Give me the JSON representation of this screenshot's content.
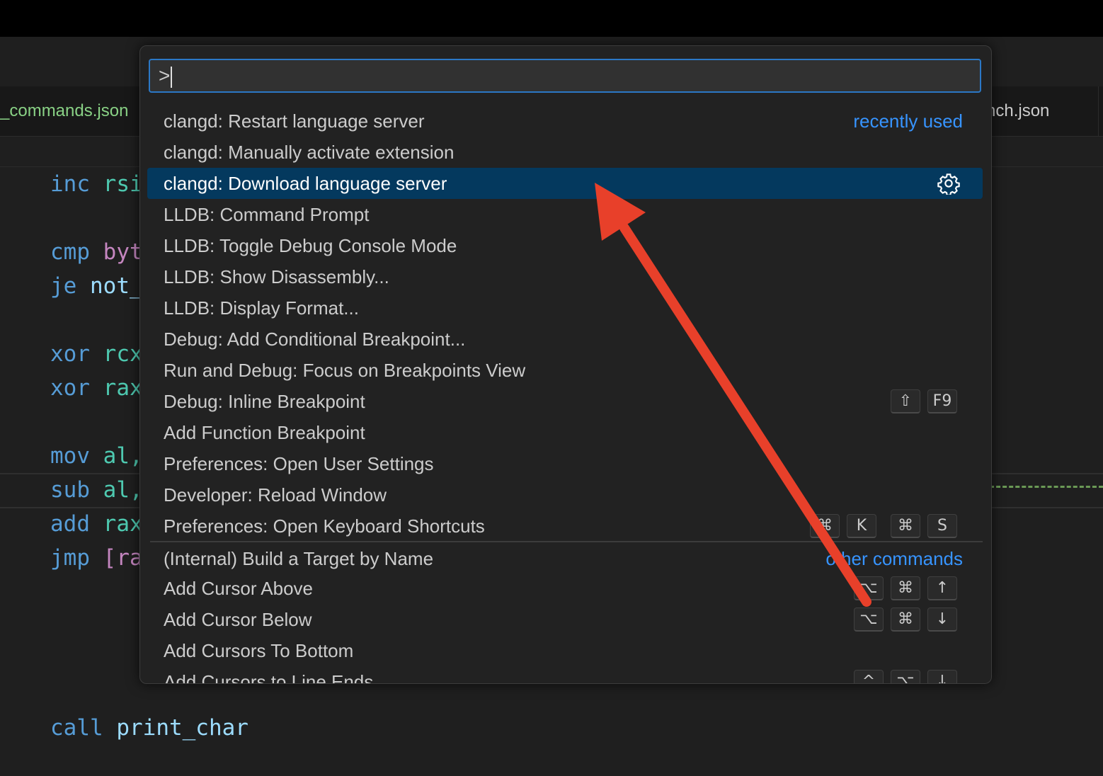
{
  "tabs": {
    "left": "_commands.json",
    "right": "nch.json"
  },
  "editor": {
    "lines": [
      {
        "op": "inc",
        "arg": "rsi"
      },
      {
        "op": "cmp",
        "arg": "byt"
      },
      {
        "op": "je",
        "arg": "not_"
      },
      {
        "op": "xor",
        "arg": "rcx"
      },
      {
        "op": "xor",
        "arg": "rax"
      },
      {
        "op": "mov",
        "arg": "al,"
      },
      {
        "op": "sub",
        "arg": "al,"
      },
      {
        "op": "add",
        "arg": "rax"
      },
      {
        "op": "jmp",
        "arg": "[ra"
      },
      {
        "op": "call",
        "arg": "print_char"
      }
    ]
  },
  "palette": {
    "input_value": ">",
    "items": [
      {
        "label": "clangd: Restart language server",
        "hint": "recently used",
        "keys": []
      },
      {
        "label": "clangd: Manually activate extension",
        "hint": "",
        "keys": []
      },
      {
        "label": "clangd: Download language server",
        "hint": "",
        "keys": [],
        "selected": true,
        "icon": "gear-icon"
      },
      {
        "label": "LLDB: Command Prompt",
        "hint": "",
        "keys": []
      },
      {
        "label": "LLDB: Toggle Debug Console Mode",
        "hint": "",
        "keys": []
      },
      {
        "label": "LLDB: Show Disassembly...",
        "hint": "",
        "keys": []
      },
      {
        "label": "LLDB: Display Format...",
        "hint": "",
        "keys": []
      },
      {
        "label": "Debug: Add Conditional Breakpoint...",
        "hint": "",
        "keys": []
      },
      {
        "label": "Run and Debug: Focus on Breakpoints View",
        "hint": "",
        "keys": []
      },
      {
        "label": "Debug: Inline Breakpoint",
        "hint": "",
        "keys": [
          "⇧",
          "F9"
        ]
      },
      {
        "label": "Add Function Breakpoint",
        "hint": "",
        "keys": []
      },
      {
        "label": "Preferences: Open User Settings",
        "hint": "",
        "keys": []
      },
      {
        "label": "Developer: Reload Window",
        "hint": "",
        "keys": []
      },
      {
        "label": "Preferences: Open Keyboard Shortcuts",
        "hint": "",
        "keys": [
          "⌘",
          "K",
          "|",
          "⌘",
          "S"
        ]
      },
      {
        "label": "(Internal) Build a Target by Name",
        "hint": "other commands",
        "keys": []
      },
      {
        "label": "Add Cursor Above",
        "hint": "",
        "keys": [
          "⌥",
          "⌘",
          "↑"
        ]
      },
      {
        "label": "Add Cursor Below",
        "hint": "",
        "keys": [
          "⌥",
          "⌘",
          "↓"
        ]
      },
      {
        "label": "Add Cursors To Bottom",
        "hint": "",
        "keys": []
      },
      {
        "label": "Add Cursors to Line Ends",
        "hint": "",
        "keys": [
          "^",
          "⌥",
          "↓"
        ]
      }
    ]
  },
  "colors": {
    "selection": "#04395e",
    "accent": "#3794ff",
    "arrow": "#e8402a"
  }
}
